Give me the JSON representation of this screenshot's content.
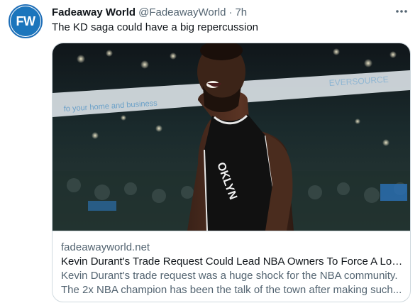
{
  "tweet": {
    "author": {
      "avatar_initials": "FW",
      "display_name": "Fadeaway World",
      "handle": "@FadeawayWorld",
      "separator": "·",
      "time": "7h"
    },
    "text": "The KD saga could have a big repercussion",
    "more_icon": "more-horizontal-icon"
  },
  "card": {
    "image_description_icon": "photo",
    "domain": "fadeawayworld.net",
    "title": "Kevin Durant's Trade Request Could Lead NBA Owners To Force A Loc...",
    "description_line1": "Kevin Durant's trade request was a huge shock for the NBA community.",
    "description_line2": "The 2x NBA champion has been the talk of the town after making such...",
    "banner_text_left": "fo your home and business",
    "banner_text_right": "EVERSOURCE",
    "jersey_text": "OKLYN"
  },
  "colors": {
    "brand_blue": "#1b75bc",
    "text_primary": "#0f1419",
    "text_secondary": "#536471",
    "border": "#cfd9de"
  }
}
